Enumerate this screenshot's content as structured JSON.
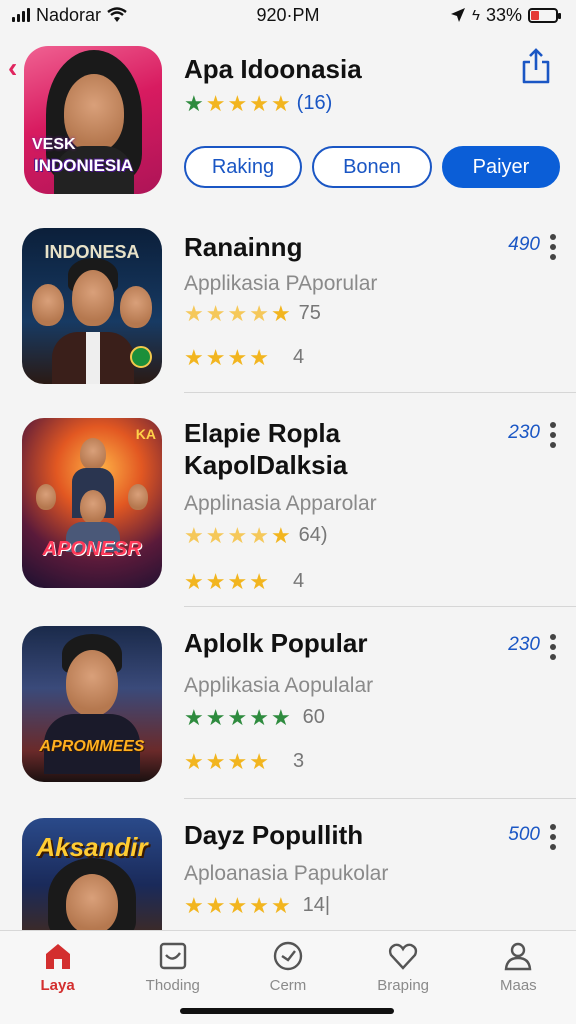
{
  "status_bar": {
    "carrier": "Nadorar",
    "time": "920·PM",
    "battery": "33%",
    "battery_level": 0.33
  },
  "header": {
    "title": "Apa Idoonasia",
    "rating_count": "(16)",
    "hero_text_top": "VESK",
    "hero_text_bottom": "INDONIESIA",
    "pills": [
      "Raking",
      "Bonen",
      "Paiyer"
    ]
  },
  "apps": [
    {
      "title": "Ranainng",
      "subtitle": "Applikasia PAporular",
      "rating1": "75",
      "rating2": "4",
      "count": "490",
      "icon_text": "INDONESA"
    },
    {
      "title": "Elapie Ropla",
      "title2": "KapolDalksia",
      "subtitle": "Applinasia Apparolar",
      "rating1": "64)",
      "rating2": "4",
      "count": "230",
      "icon_text": "APONESR"
    },
    {
      "title": "Aplolk Popular",
      "subtitle": "Applikasia Aopulalar",
      "rating1": "60",
      "rating2": "3",
      "count": "230",
      "icon_text": "APROMMEES"
    },
    {
      "title": "Dayz Popullith",
      "subtitle": "Aploanasia Papukolar",
      "rating1": "14|",
      "count": "500",
      "icon_text": "Aksandir"
    }
  ],
  "tabs": [
    {
      "label": "Laya",
      "icon": "home-icon"
    },
    {
      "label": "Thoding",
      "icon": "image-icon"
    },
    {
      "label": "Cerm",
      "icon": "compass-icon"
    },
    {
      "label": "Braping",
      "icon": "heart-icon"
    },
    {
      "label": "Maas",
      "icon": "person-icon"
    }
  ],
  "colors": {
    "accent_blue": "#0b5ed7",
    "active_tab": "#d32f2f",
    "star_gold": "#f2b51f",
    "star_green": "#2e8b3e"
  }
}
